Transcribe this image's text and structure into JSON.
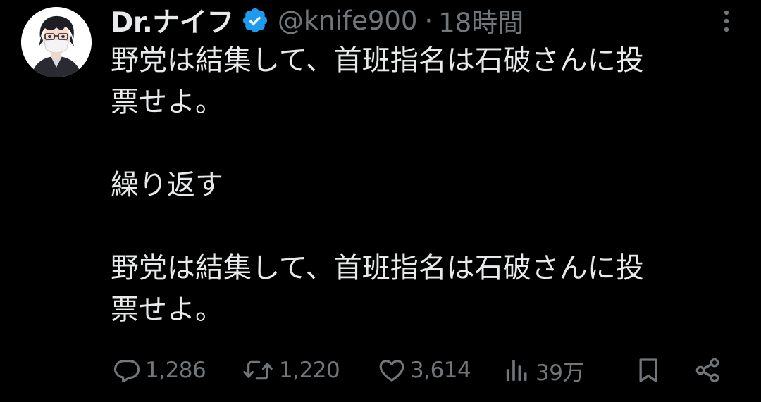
{
  "tweet": {
    "author_name": "Dr.ナイフ",
    "verified_icon": "verified-badge-icon",
    "handle": "@knife900",
    "separator": "·",
    "time": "18時間",
    "text": {
      "p1_line1": "野党は結集して、首班指名は石破さんに投",
      "p1_line2": "票せよ。",
      "p2": "繰り返す",
      "p3_line1": "野党は結集して、首班指名は石破さんに投",
      "p3_line2": "票せよ。"
    }
  },
  "actions": {
    "reply_count": "1,286",
    "retweet_count": "1,220",
    "like_count": "3,614",
    "views_count": "39万"
  },
  "colors": {
    "background": "#000000",
    "text": "#e7e9ea",
    "secondary": "#71767b",
    "verified": "#1d9bf0"
  }
}
